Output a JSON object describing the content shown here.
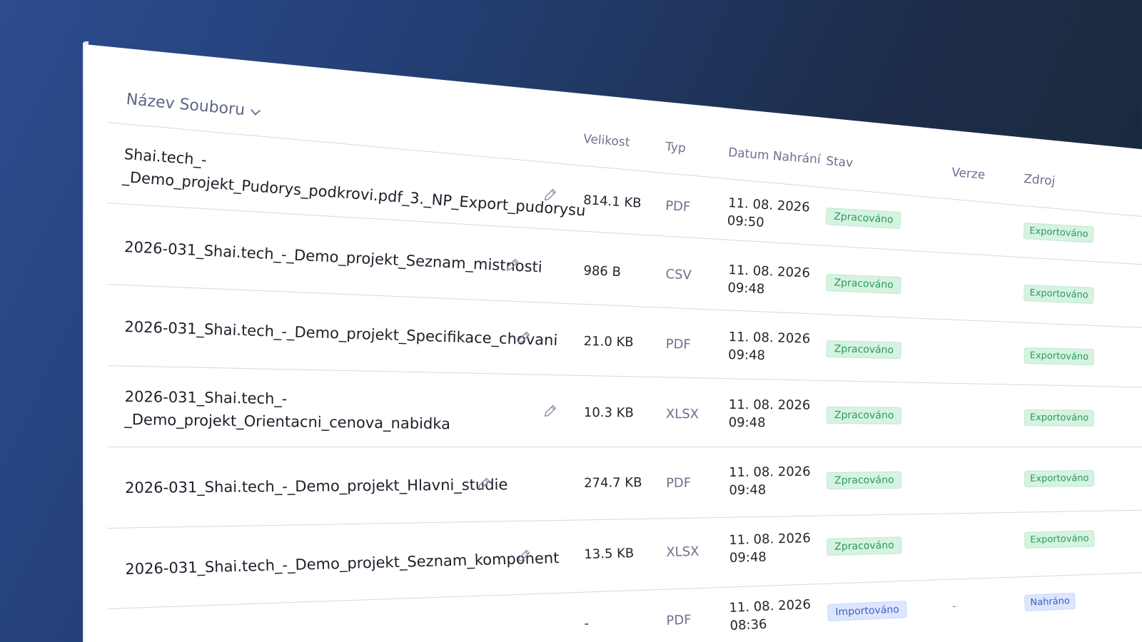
{
  "table": {
    "sort_label": "Název Souboru",
    "columns": {
      "size": "Velikost",
      "type": "Typ",
      "date": "Datum Nahrání",
      "status": "Stav",
      "version": "Verze",
      "source": "Zdroj"
    },
    "rows": [
      {
        "name_line1": "Shai.tech_-",
        "name_line2": "_Demo_projekt_Pudorys_podkrovi.pdf_3._NP_Export_pudorysu",
        "size": "814.1 KB",
        "type": "PDF",
        "date": "11. 08. 2026",
        "time": "09:50",
        "status": "Zpracováno",
        "version": "",
        "source": "Exportováno"
      },
      {
        "name_line1": "2026-031_Shai.tech_-_Demo_projekt_Seznam_mistnosti",
        "name_line2": "",
        "size": "986 B",
        "type": "CSV",
        "date": "11. 08. 2026",
        "time": "09:48",
        "status": "Zpracováno",
        "version": "",
        "source": "Exportováno"
      },
      {
        "name_line1": "2026-031_Shai.tech_-_Demo_projekt_Specifikace_chovani",
        "name_line2": "",
        "size": "21.0 KB",
        "type": "PDF",
        "date": "11. 08. 2026",
        "time": "09:48",
        "status": "Zpracováno",
        "version": "",
        "source": "Exportováno"
      },
      {
        "name_line1": "2026-031_Shai.tech_-",
        "name_line2": "_Demo_projekt_Orientacni_cenova_nabidka",
        "size": "10.3 KB",
        "type": "XLSX",
        "date": "11. 08. 2026",
        "time": "09:48",
        "status": "Zpracováno",
        "version": "",
        "source": "Exportováno"
      },
      {
        "name_line1": "2026-031_Shai.tech_-_Demo_projekt_Hlavni_studie",
        "name_line2": "",
        "size": "274.7 KB",
        "type": "PDF",
        "date": "11. 08. 2026",
        "time": "09:48",
        "status": "Zpracováno",
        "version": "",
        "source": "Exportováno"
      },
      {
        "name_line1": "2026-031_Shai.tech_-_Demo_projekt_Seznam_komponent",
        "name_line2": "",
        "size": "13.5 KB",
        "type": "XLSX",
        "date": "11. 08. 2026",
        "time": "09:48",
        "status": "Zpracováno",
        "version": "",
        "source": "Exportováno"
      },
      {
        "name_line1": "",
        "name_line2": "",
        "size": "-",
        "type": "PDF",
        "date": "11. 08. 2026",
        "time": "08:36",
        "status": "Importováno",
        "version": "-",
        "source": "Nahráno"
      }
    ]
  },
  "colors": {
    "processed_badge": "#d6f3e1",
    "imported_badge": "#dce6ff"
  },
  "icons": {
    "edit": "pencil-icon",
    "sort": "chevron-down-icon"
  }
}
